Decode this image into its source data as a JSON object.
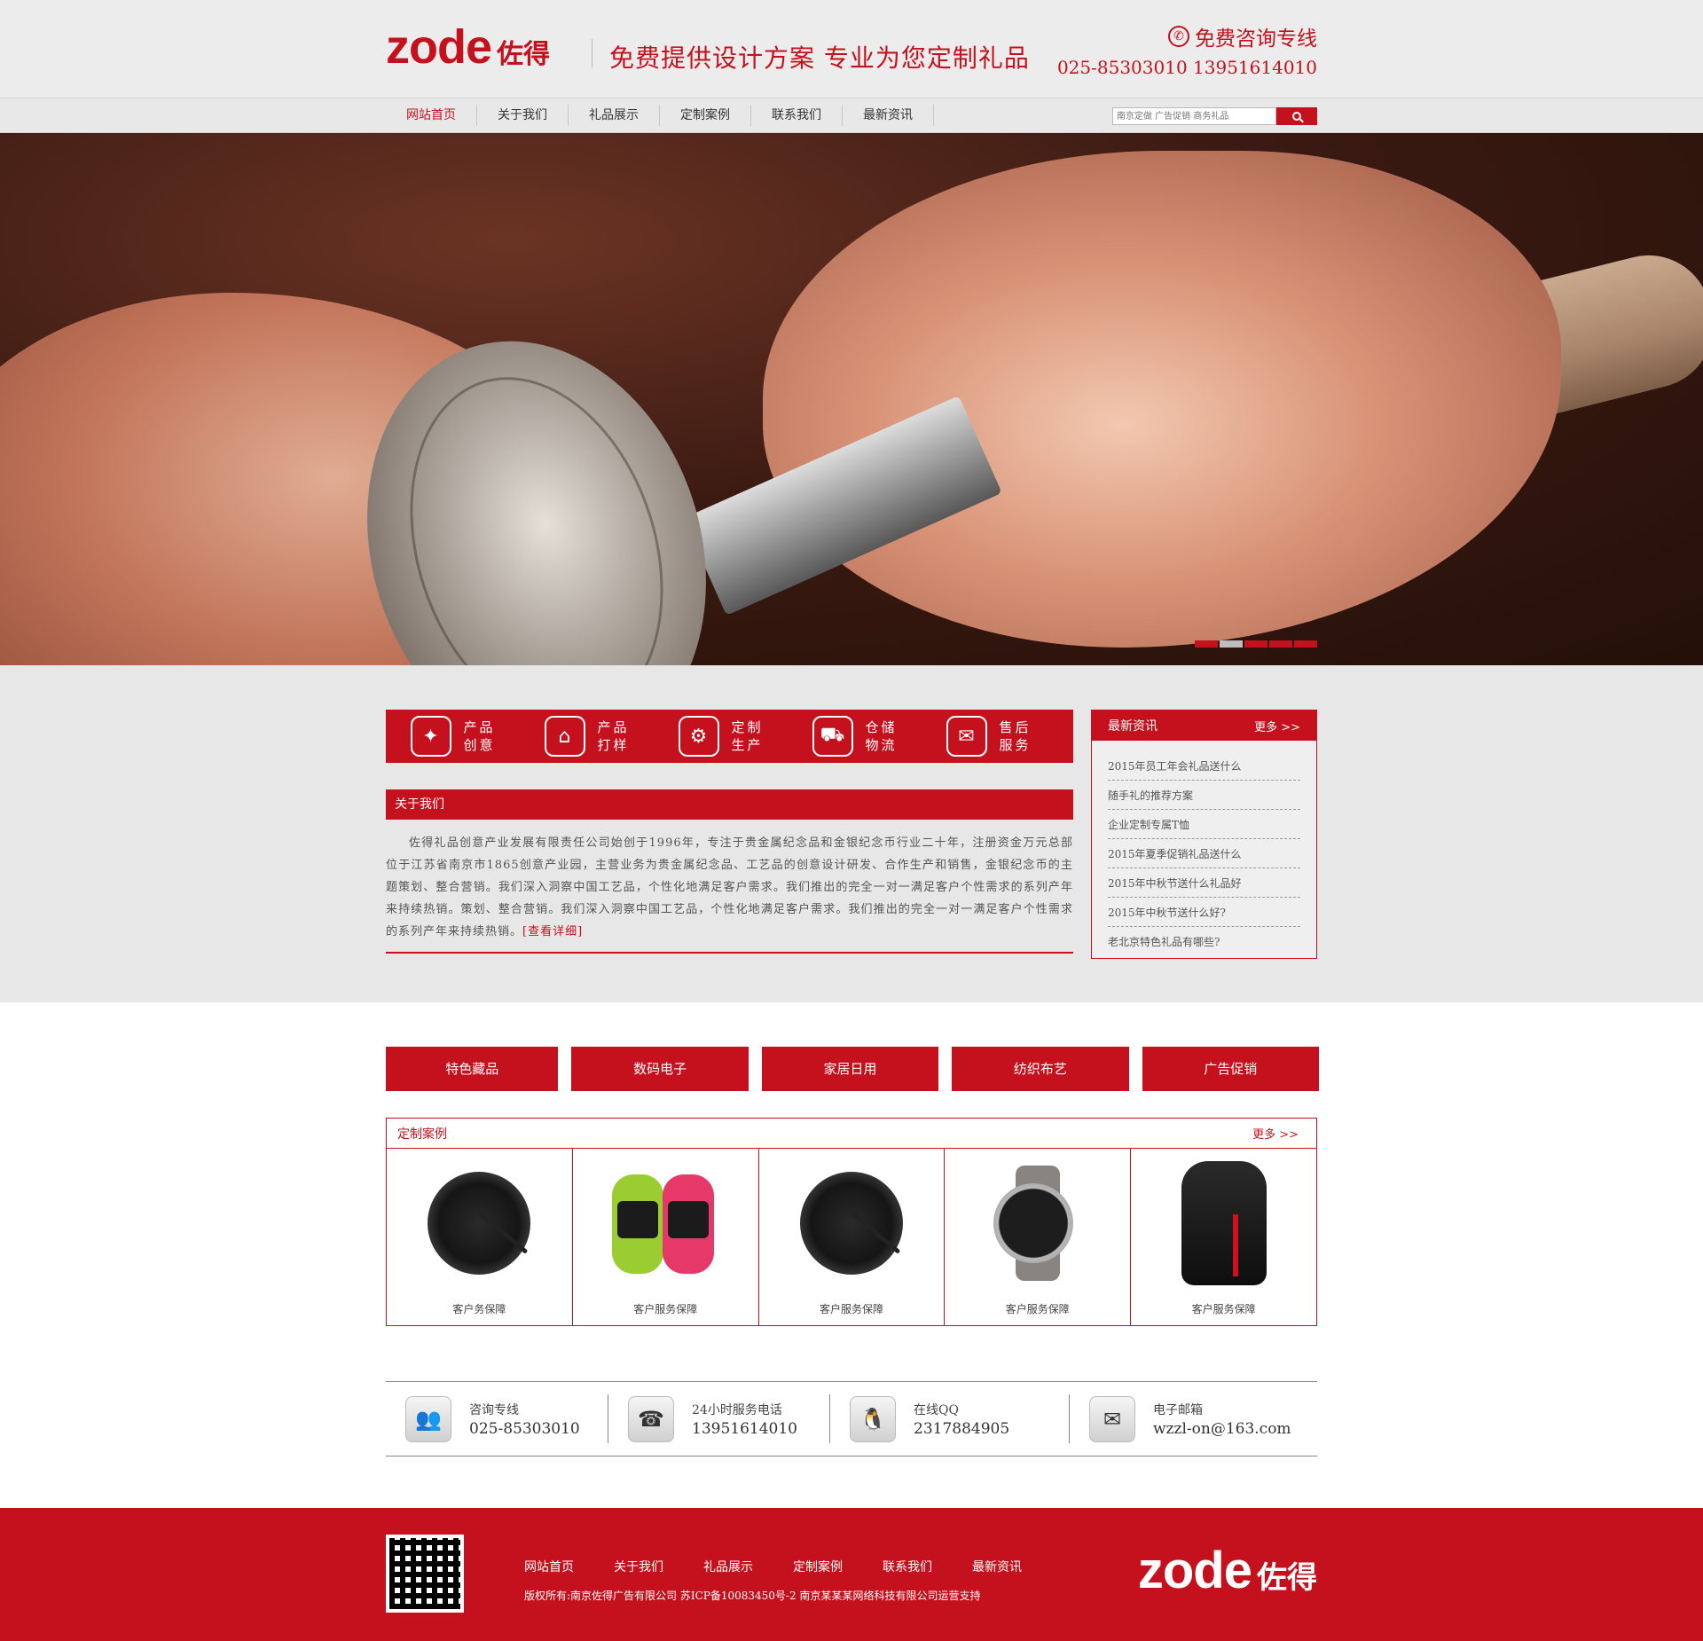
{
  "header": {
    "logo_en": "zode",
    "logo_cn": "佐得",
    "slogan": "免费提供设计方案  专业为您定制礼品",
    "hotline_title": "免费咨询专线",
    "hotline_numbers": "025-85303010  13951614010"
  },
  "nav": {
    "items": [
      "网站首页",
      "关于我们",
      "礼品展示",
      "定制案例",
      "联系我们",
      "最新资讯"
    ],
    "active_index": 0,
    "search_placeholder": "南京定做 广告促销 商务礼品"
  },
  "banner": {
    "active_slide": 2,
    "slide_count": 5
  },
  "services": [
    {
      "icon": "lightbulb-icon",
      "glyph": "✦",
      "label": "产品创意"
    },
    {
      "icon": "compass-icon",
      "glyph": "⌂",
      "label": "产品打样"
    },
    {
      "icon": "gears-icon",
      "glyph": "⚙",
      "label": "定制生产"
    },
    {
      "icon": "truck-icon",
      "glyph": "⛟",
      "label": "仓储物流"
    },
    {
      "icon": "chat-icon",
      "glyph": "✉",
      "label": "售后服务"
    }
  ],
  "about": {
    "title": "关于我们",
    "body": "佐得礼品创意产业发展有限责任公司始创于1996年，专注于贵金属纪念品和金银纪念币行业二十年，注册资金万元总部位于江苏省南京市1865创意产业园，主营业务为贵金属纪念品、工艺品的创意设计研发、合作生产和销售，金银纪念币的主题策划、整合营销。我们深入洞察中国工艺品，个性化地满足客户需求。我们推出的完全一对一满足客户个性需求的系列产年来持续热销。策划、整合营销。我们深入洞察中国工艺品，个性化地满足客户需求。我们推出的完全一对一满足客户个性需求的系列产年来持续热销。",
    "more": "[查看详细]"
  },
  "news": {
    "title": "最新资讯",
    "more": "更多 >>",
    "items": [
      "2015年员工年会礼品送什么",
      "随手礼的推荐方案",
      "企业定制专属T恤",
      "2015年夏季促销礼品送什么",
      "2015年中秋节送什么礼品好",
      "2015年中秋节送什么好?",
      "老北京特色礼品有哪些?"
    ]
  },
  "categories": [
    "特色藏品",
    "数码电子",
    "家居日用",
    "纺织布艺",
    "广告促销"
  ],
  "cases": {
    "title": "定制案例",
    "more": "更多 >>",
    "items": [
      {
        "label": "客户务保障",
        "image": "speaker"
      },
      {
        "label": "客户服务保障",
        "image": "wristbands"
      },
      {
        "label": "客户服务保障",
        "image": "speaker"
      },
      {
        "label": "客户服务保障",
        "image": "watch"
      },
      {
        "label": "客户服务保障",
        "image": "backpack"
      }
    ]
  },
  "contact": [
    {
      "icon": "users-icon",
      "glyph": "👥",
      "label": "咨询专线",
      "value": "025-85303010"
    },
    {
      "icon": "telephone-icon",
      "glyph": "☎",
      "label": "24小时服务电话",
      "value": "13951614010"
    },
    {
      "icon": "qq-penguin-icon",
      "glyph": "🐧",
      "label": "在线QQ",
      "value": "2317884905"
    },
    {
      "icon": "mailbox-icon",
      "glyph": "✉",
      "label": "电子邮箱",
      "value": "wzzl-on@163.com"
    }
  ],
  "footer": {
    "nav": [
      "网站首页",
      "关于我们",
      "礼品展示",
      "定制案例",
      "联系我们",
      "最新资讯"
    ],
    "copyright": "版权所有:南京佐得广告有限公司 苏ICP备10083450号-2  南京某某某网络科技有限公司运营支持",
    "logo_en": "zode",
    "logo_cn": "佐得"
  },
  "colors": {
    "brand_red": "#c4111d",
    "gray_bg": "#e7e7e7"
  }
}
